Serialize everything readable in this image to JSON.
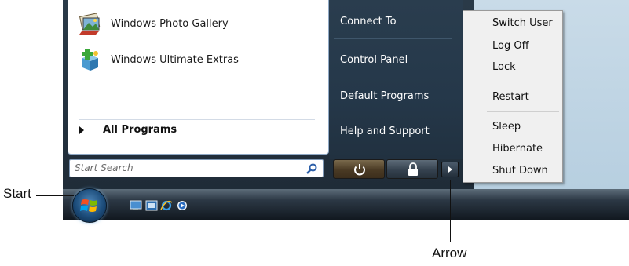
{
  "programs": [
    {
      "label": "Windows Photo Gallery",
      "icon": "photo-gallery-icon"
    },
    {
      "label": "Windows Ultimate Extras",
      "icon": "ultimate-extras-icon"
    }
  ],
  "all_programs": "All Programs",
  "search": {
    "placeholder": "Start Search",
    "icon": "search-icon"
  },
  "right_items": [
    "Connect To",
    "Control Panel",
    "Default Programs",
    "Help and Support"
  ],
  "power_menu": [
    "Switch User",
    "Log Off",
    "Lock",
    "Restart",
    "Sleep",
    "Hibernate",
    "Shut Down"
  ],
  "callouts": {
    "start": "Start",
    "arrow": "Arrow"
  },
  "quick_launch": [
    "show-desktop-icon",
    "switch-windows-icon",
    "internet-explorer-icon",
    "media-player-icon"
  ],
  "colors": {
    "menu_dark": "#25384a",
    "submenu_bg": "#f0f0f0",
    "power_button": "#5a4a30"
  }
}
